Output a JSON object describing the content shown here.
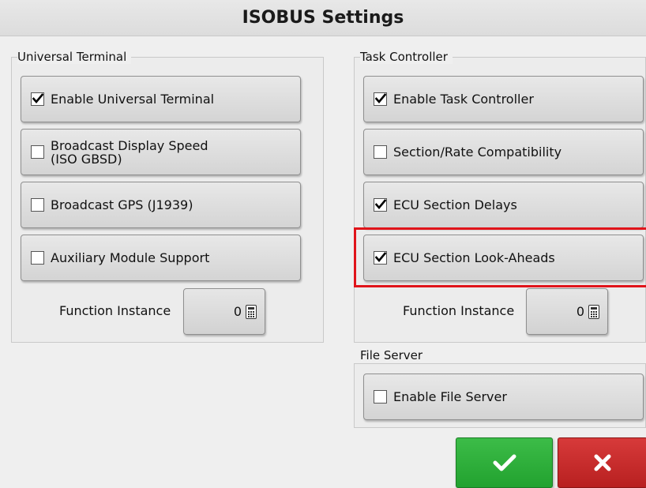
{
  "title": "ISOBUS Settings",
  "universal_terminal": {
    "label": "Universal Terminal",
    "options": [
      {
        "label": "Enable Universal Terminal",
        "checked": true
      },
      {
        "label": "Broadcast Display Speed\n(ISO GBSD)",
        "checked": false
      },
      {
        "label": "Broadcast GPS (J1939)",
        "checked": false
      },
      {
        "label": "Auxiliary Module Support",
        "checked": false
      }
    ],
    "function_instance_label": "Function Instance",
    "function_instance_value": "0"
  },
  "task_controller": {
    "label": "Task Controller",
    "options": [
      {
        "label": "Enable Task Controller",
        "checked": true
      },
      {
        "label": "Section/Rate Compatibility",
        "checked": false
      },
      {
        "label": "ECU Section Delays",
        "checked": true
      },
      {
        "label": "ECU Section Look-Aheads",
        "checked": true
      }
    ],
    "function_instance_label": "Function Instance",
    "function_instance_value": "0"
  },
  "file_server": {
    "label": "File Server",
    "options": [
      {
        "label": "Enable File Server",
        "checked": false
      }
    ]
  },
  "actions": {
    "ok_icon": "checkmark-icon",
    "cancel_icon": "x-icon"
  },
  "colors": {
    "highlight": "#e0141a",
    "ok": "#2bad38",
    "cancel": "#c42a2a"
  }
}
